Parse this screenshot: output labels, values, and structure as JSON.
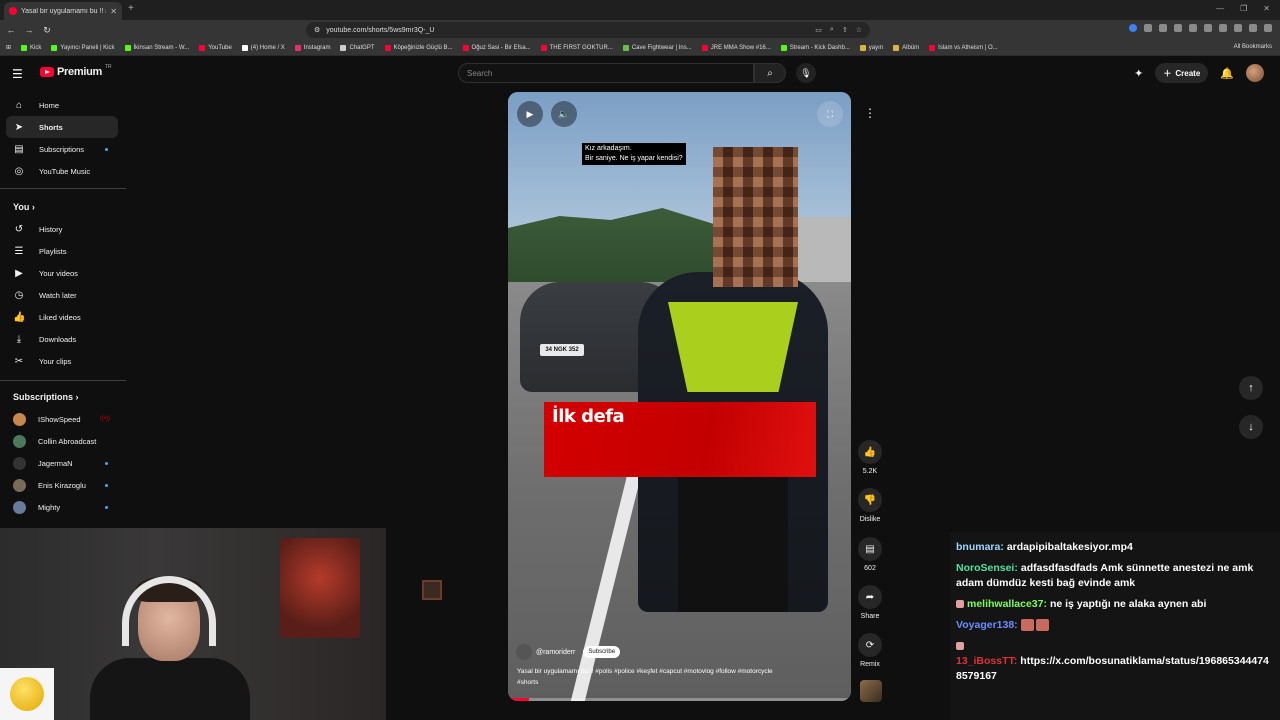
{
  "browser": {
    "tab_title": "Yasal bir uygulamamı bu !! #poli",
    "url": "youtube.com/shorts/5ws9mr3Q-_U",
    "bookmarks": [
      {
        "label": "Kick",
        "color": "#53fc18"
      },
      {
        "label": "Yayıncı Paneli | Kick",
        "color": "#53fc18"
      },
      {
        "label": "İkinsan Stream - W...",
        "color": "#53fc18"
      },
      {
        "label": "YouTube",
        "color": "#ff0033"
      },
      {
        "label": "(4) Home / X",
        "color": "#ffffff"
      },
      {
        "label": "Instagram",
        "color": "#e1306c"
      },
      {
        "label": "ChatGPT",
        "color": "#cccccc"
      },
      {
        "label": "Köpeğinizle Güçlü B...",
        "color": "#ff0033"
      },
      {
        "label": "Oğuz Sasi - Bir Efsa...",
        "color": "#ff0033"
      },
      {
        "label": "THE FIRST GOKTUR...",
        "color": "#ff0033"
      },
      {
        "label": "Cave Fightwear | Ins...",
        "color": "#6abf4b"
      },
      {
        "label": "JRE MMA Show #16...",
        "color": "#ff0033"
      },
      {
        "label": "Stream - Kick Dashb...",
        "color": "#53fc18"
      },
      {
        "label": "yayın",
        "color": "#e0b040"
      },
      {
        "label": "Albüm",
        "color": "#e0b040"
      },
      {
        "label": "Islam vs Atheism | O...",
        "color": "#ff0033"
      }
    ],
    "all_bookmarks": "All Bookmarks"
  },
  "header": {
    "logo_text": "Premium",
    "logo_tr": "TR",
    "search_placeholder": "Search",
    "create_label": "Create"
  },
  "sidebar": {
    "items": [
      {
        "label": "Home",
        "icon": "home-icon",
        "glyph": "⌂"
      },
      {
        "label": "Shorts",
        "icon": "shorts-icon",
        "glyph": "➤"
      },
      {
        "label": "Subscriptions",
        "icon": "subscriptions-icon",
        "glyph": "▤"
      },
      {
        "label": "YouTube Music",
        "icon": "music-icon",
        "glyph": "◎"
      }
    ],
    "you_heading": "You",
    "you_items": [
      {
        "label": "History",
        "glyph": "↺"
      },
      {
        "label": "Playlists",
        "glyph": "☰"
      },
      {
        "label": "Your videos",
        "glyph": "▶"
      },
      {
        "label": "Watch later",
        "glyph": "◷"
      },
      {
        "label": "Liked videos",
        "glyph": "👍"
      },
      {
        "label": "Downloads",
        "glyph": "⤓"
      },
      {
        "label": "Your clips",
        "glyph": "✂"
      }
    ],
    "subs_heading": "Subscriptions",
    "subs": [
      {
        "label": "IShowSpeed",
        "color": "#c8874f"
      },
      {
        "label": "Collin Abroadcast",
        "color": "#4a7a5a"
      },
      {
        "label": "JagermaN",
        "color": "#333333"
      },
      {
        "label": "Enis Kirazoglu",
        "color": "#7a6a5a"
      },
      {
        "label": "Mighty",
        "color": "#6a7a9a"
      }
    ]
  },
  "video": {
    "subtitle_line1": "Kız arkadaşım.",
    "subtitle_line2": "Bir saniye. Ne iş yapar kendisi?",
    "banner_text": "İlk defa",
    "plate": "34 NGK 352",
    "channel": "@ramoriderr",
    "subscribe_label": "Subscribe",
    "description": "Yasal bir uygulamamı bu !! #polis #police #keşfet #capcut #motovlog #follow #motorcycle #shorts",
    "progress": 0.06
  },
  "actions": {
    "like_count": "5.2K",
    "dislike_label": "Dislike",
    "comment_count": "602",
    "share_label": "Share",
    "remix_label": "Remix"
  },
  "chat": [
    {
      "user": "bnumara:",
      "color": "#9fd6ff",
      "text": "ardapipibaltakesiyor.mp4"
    },
    {
      "user": "NoroSensei:",
      "color": "#4fe3a0",
      "text": "adfasdfasdfads Amk sünnette anestezi ne amk adam dümdüz kesti bağ evinde amk"
    },
    {
      "user": "melihwallace37:",
      "color": "#7cff5a",
      "text": "ne iş yaptığı ne alaka aynen abi"
    },
    {
      "user": "Voyager138:",
      "color": "#6f8cff",
      "text": ""
    },
    {
      "user": "13_iBossTT:",
      "color": "#e0313a",
      "text": "https://x.com/bosunatiklama/status/1968653444748579167"
    }
  ]
}
